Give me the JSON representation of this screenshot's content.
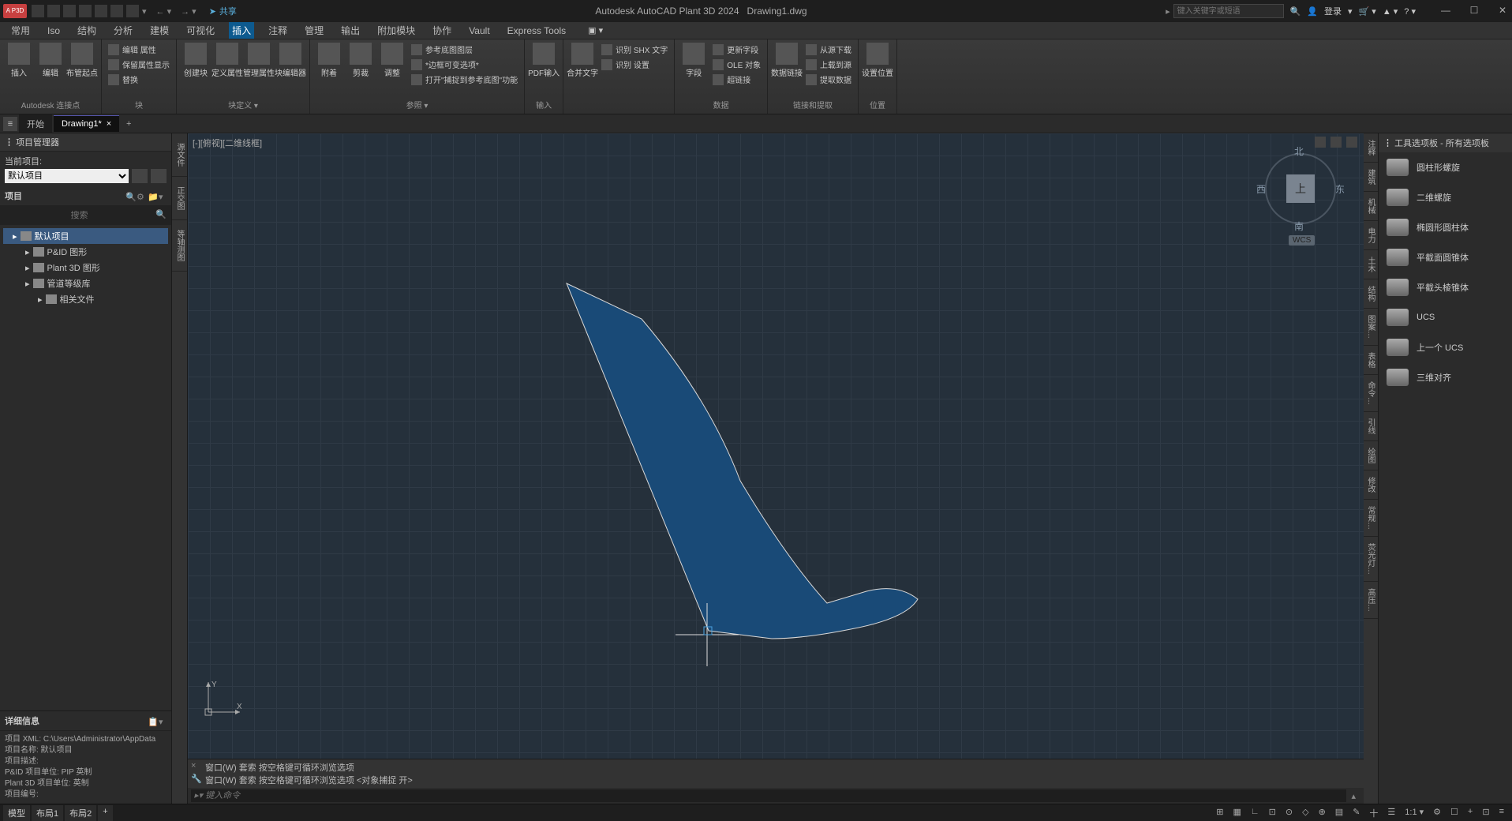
{
  "titlebar": {
    "app_title": "Autodesk AutoCAD Plant 3D 2024",
    "doc_title": "Drawing1.dwg",
    "share_label": "共享",
    "search_placeholder": "键入关键字或短语",
    "login_label": "登录",
    "logo_text": "A P3D"
  },
  "menubar": {
    "items": [
      "常用",
      "Iso",
      "结构",
      "分析",
      "建模",
      "可视化",
      "插入",
      "注释",
      "管理",
      "输出",
      "附加模块",
      "协作",
      "Vault",
      "Express Tools"
    ],
    "active_index": 6
  },
  "ribbon": {
    "panels": [
      {
        "name": "Autodesk 连接点",
        "big": [
          {
            "label": "插入"
          },
          {
            "label": "编辑"
          },
          {
            "label": "布管起点"
          }
        ]
      },
      {
        "name": "块",
        "small": [
          "编辑 属性",
          "保留属性显示",
          "替换"
        ]
      },
      {
        "name": "块定义 ▾",
        "big": [
          {
            "label": "创建块"
          },
          {
            "label": "定义属性"
          },
          {
            "label": "管理属性"
          },
          {
            "label": "块编辑器"
          }
        ]
      },
      {
        "name": "参照 ▾",
        "big": [
          {
            "label": "附着"
          },
          {
            "label": "剪裁"
          },
          {
            "label": "调整"
          }
        ],
        "small": [
          "参考底图图层",
          "*边框可变选项*",
          "打开\"捕捉到参考底图\"功能"
        ]
      },
      {
        "name": "输入",
        "big": [
          {
            "label": "PDF输入"
          }
        ]
      },
      {
        "name": "",
        "small": [
          "识别 SHX 文字",
          "识别 设置"
        ],
        "big": [
          {
            "label": "合并文字"
          }
        ]
      },
      {
        "name": "数据",
        "big": [
          {
            "label": "字段"
          }
        ],
        "small": [
          "更新字段",
          "OLE 对象",
          "超链接"
        ]
      },
      {
        "name": "链接和提取",
        "big": [
          {
            "label": "数据链接"
          }
        ],
        "small": [
          "从源下载",
          "上载到源",
          "提取数据"
        ]
      },
      {
        "name": "位置",
        "big": [
          {
            "label": "设置位置"
          }
        ]
      }
    ]
  },
  "doctabs": {
    "tabs": [
      {
        "label": "开始"
      },
      {
        "label": "Drawing1*"
      }
    ],
    "active_index": 1
  },
  "left_panel": {
    "header": "项目管理器",
    "current_project_label": "当前项目:",
    "current_project_value": "默认项目",
    "project_section": "项目",
    "search_placeholder": "搜索",
    "tree": [
      {
        "label": "默认项目",
        "selected": true
      },
      {
        "label": "P&ID 图形",
        "child": true
      },
      {
        "label": "Plant 3D 图形",
        "child": true
      },
      {
        "label": "管道等级库",
        "child": true
      },
      {
        "label": "相关文件",
        "child2": true
      }
    ],
    "details_header": "详细信息",
    "details": [
      "项目 XML: C:\\Users\\Administrator\\AppData",
      "项目名称: 默认项目",
      "项目描述:",
      "P&ID 项目单位: PIP 英制",
      "Plant 3D 项目单位: 英制",
      "项目编号:"
    ]
  },
  "vtabs": [
    "源文件",
    "正交图",
    "等轴测图"
  ],
  "canvas": {
    "viewport_label": "[-][俯视][二维线框]",
    "viewcube": {
      "face": "上",
      "n": "北",
      "s": "南",
      "e": "东",
      "w": "西",
      "wcs": "WCS"
    },
    "axis": {
      "x": "X",
      "y": "Y"
    }
  },
  "command": {
    "history": [
      "窗口(W) 套索  按空格键可循环浏览选项",
      "窗口(W) 套索  按空格键可循环浏览选项 <对象捕捉 开>"
    ],
    "prompt": "▸▾ 键入命令"
  },
  "right_vtabs": [
    "注释",
    "建筑",
    "机械",
    "电力",
    "土木",
    "结构",
    "图案…",
    "表格",
    "命令…",
    "引线",
    "绘图",
    "修改",
    "常规…",
    "荧光灯…",
    "高压…"
  ],
  "tool_palette": {
    "header": "工具选项板 - 所有选项板",
    "items": [
      {
        "label": "圆柱形螺旋"
      },
      {
        "label": "二维螺旋"
      },
      {
        "label": "椭圆形圆柱体"
      },
      {
        "label": "平截面圆锥体"
      },
      {
        "label": "平截头棱锥体"
      },
      {
        "label": "UCS"
      },
      {
        "label": "上一个 UCS"
      },
      {
        "label": "三维对齐"
      }
    ]
  },
  "statusbar": {
    "left_tabs": [
      "模型",
      "布局1",
      "布局2"
    ],
    "scale": "1:1",
    "items": [
      "⊞",
      "▦",
      "∟",
      "⊡",
      "⊙",
      "◇",
      "⊕",
      "▤",
      "✎",
      "十",
      "☰"
    ]
  }
}
